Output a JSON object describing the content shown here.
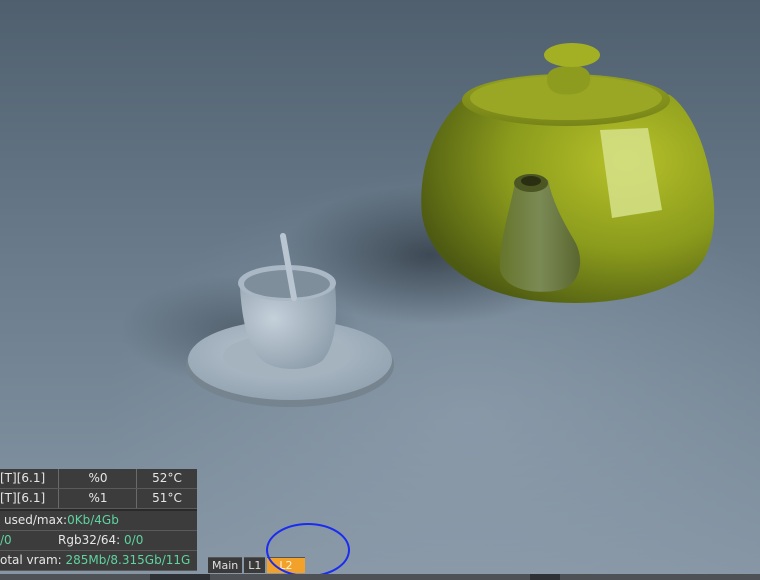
{
  "stats": {
    "rows": [
      {
        "device": "[T][6.1]",
        "load": "%0",
        "temp": "52°C"
      },
      {
        "device": "[T][6.1]",
        "load": "%1",
        "temp": "51°C"
      }
    ],
    "memory_label": "used/max:",
    "memory_value": "0Kb/4Gb",
    "rgb_left": "/0",
    "rgb_label": "Rgb32/64:",
    "rgb_value": "0/0",
    "vram_label": "otal vram:",
    "vram_value": "285Mb/8.315Gb/11G"
  },
  "tabs": [
    {
      "label": "Main",
      "active": false
    },
    {
      "label": "L1",
      "active": false
    },
    {
      "label": "L2",
      "active": true
    }
  ],
  "colors": {
    "teapot": "#8a9a1c",
    "cup": "#aab9c6",
    "stats_value": "#5fd3a0",
    "active_tab": "#f2a22a",
    "annotation": "#1a2cf0"
  }
}
